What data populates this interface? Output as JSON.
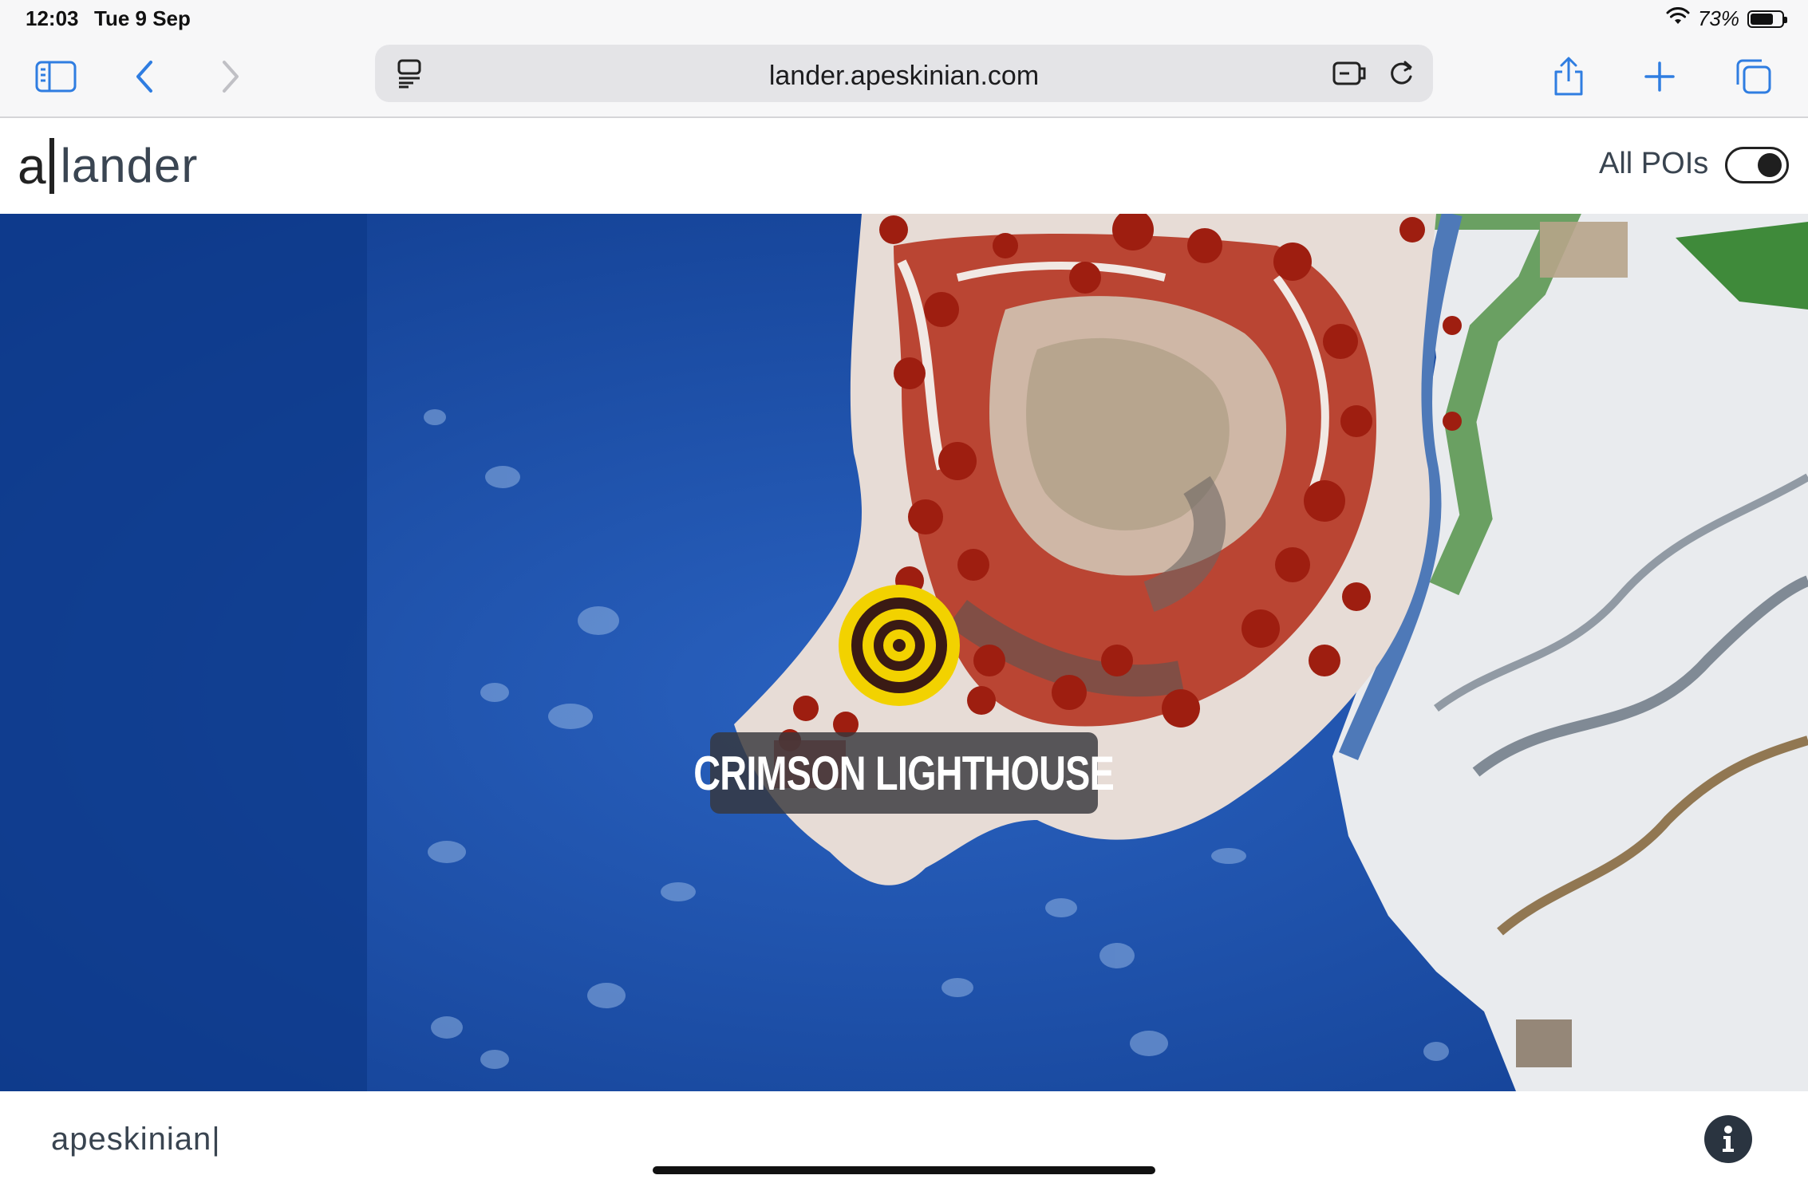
{
  "status_bar": {
    "time": "12:03",
    "date": "Tue 9 Sep",
    "battery_text": "73%",
    "battery_level": 0.73,
    "icons": [
      "wifi-icon",
      "battery-icon"
    ]
  },
  "browser": {
    "url": "lander.apeskinian.com",
    "icons": [
      "sidebar-icon",
      "back-icon",
      "forward-icon",
      "reader-icon",
      "extension-icon",
      "reload-icon",
      "share-icon",
      "plus-icon",
      "tabs-icon"
    ]
  },
  "app": {
    "logo_letter": "a",
    "logo_word": "lander",
    "poi_toggle_label": "All POIs",
    "poi_toggle_on": true
  },
  "map": {
    "poi": {
      "name": "CRIMSON LIGHTHOUSE",
      "marker_color": "#f2d200"
    },
    "colors": {
      "ocean": "#1d4fa8",
      "ocean_deep": "#0d3a8a",
      "foliage": "#b22412",
      "snow": "#f2f2f2",
      "grass": "#3f8a3a"
    }
  },
  "footer": {
    "text": "apeskinian|",
    "icons": [
      "info-icon"
    ]
  }
}
